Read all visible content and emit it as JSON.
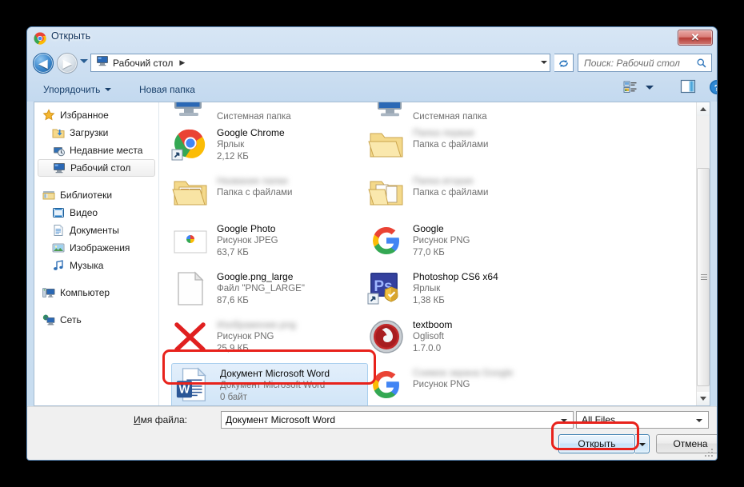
{
  "window": {
    "title": "Открыть",
    "title_icon": "chrome-icon",
    "close_label": "✕"
  },
  "nav": {
    "back_glyph": "◀",
    "forward_glyph": "▶",
    "history_icon": "chevron-down-icon",
    "breadcrumb": "Рабочий стол",
    "breadcrumb_icon": "desktop-icon",
    "breadcrumb_separator": "▶",
    "refresh_icon": "refresh-icon",
    "search_placeholder": "Поиск: Рабочий стол",
    "search_value": "",
    "search_icon": "search-icon"
  },
  "toolbar": {
    "organize_label": "Упорядочить",
    "new_folder_label": "Новая папка",
    "view_icon": "view-mode-icon",
    "view_caret_icon": "chevron-down-icon",
    "preview_pane_icon": "preview-pane-icon",
    "help_icon": "help-icon"
  },
  "sidebar": {
    "groups": [
      {
        "header": {
          "label": "Избранное",
          "icon": "star-icon"
        },
        "items": [
          {
            "label": "Загрузки",
            "icon": "downloads-icon",
            "selected": false
          },
          {
            "label": "Недавние места",
            "icon": "recent-places-icon",
            "selected": false
          },
          {
            "label": "Рабочий стол",
            "icon": "desktop-icon",
            "selected": true
          }
        ]
      },
      {
        "header": {
          "label": "Библиотеки",
          "icon": "libraries-icon"
        },
        "items": [
          {
            "label": "Видео",
            "icon": "video-icon",
            "selected": false
          },
          {
            "label": "Документы",
            "icon": "documents-icon",
            "selected": false
          },
          {
            "label": "Изображения",
            "icon": "pictures-icon",
            "selected": false
          },
          {
            "label": "Музыка",
            "icon": "music-icon",
            "selected": false
          }
        ]
      },
      {
        "header": {
          "label": "Компьютер",
          "icon": "computer-icon"
        },
        "items": []
      },
      {
        "header": {
          "label": "Сеть",
          "icon": "network-icon"
        },
        "items": []
      }
    ]
  },
  "file_list": {
    "column_left": [
      {
        "name": "",
        "type": "Системная папка",
        "size": "",
        "icon": "computer-icon",
        "partial": true,
        "blurred": false,
        "selected": false
      },
      {
        "name": "Google Chrome",
        "type": "Ярлык",
        "size": "2,12 КБ",
        "icon": "chrome-shortcut-icon",
        "partial": false,
        "blurred": false,
        "selected": false
      },
      {
        "name": "Название папки",
        "type": "Папка с файлами",
        "size": "",
        "icon": "folder-pictures-icon",
        "partial": false,
        "blurred": true,
        "selected": false
      },
      {
        "name": "Google Photo",
        "type": "Рисунок JPEG",
        "size": "63,7 КБ",
        "icon": "google-photos-icon",
        "partial": false,
        "blurred": false,
        "selected": false
      },
      {
        "name": "Google.png_large",
        "type": "Файл \"PNG_LARGE\"",
        "size": "87,6 КБ",
        "icon": "blank-file-icon",
        "partial": false,
        "blurred": false,
        "selected": false
      },
      {
        "name": "Изображение.png",
        "type": "Рисунок PNG",
        "size": "25,9 КБ",
        "icon": "red-cross-icon",
        "partial": false,
        "blurred": true,
        "selected": false
      },
      {
        "name": "Документ Microsoft Word",
        "type": "Документ Microsoft Word",
        "size": "0 байт",
        "icon": "word-document-icon",
        "partial": false,
        "blurred": false,
        "selected": true
      }
    ],
    "column_right": [
      {
        "name": "",
        "type": "Системная папка",
        "size": "",
        "icon": "network-computer-icon",
        "partial": true,
        "blurred": false,
        "selected": false
      },
      {
        "name": "Папка первая",
        "type": "Папка с файлами",
        "size": "",
        "icon": "folder-open-icon",
        "partial": false,
        "blurred": true,
        "selected": false
      },
      {
        "name": "Папка вторая",
        "type": "Папка с файлами",
        "size": "",
        "icon": "folder-docs-icon",
        "partial": false,
        "blurred": true,
        "selected": false
      },
      {
        "name": "Google",
        "type": "Рисунок PNG",
        "size": "77,0 КБ",
        "icon": "google-g-icon",
        "partial": false,
        "blurred": false,
        "selected": false
      },
      {
        "name": "Photoshop CS6 x64",
        "type": "Ярлык",
        "size": "1,38 КБ",
        "icon": "photoshop-shortcut-icon",
        "partial": false,
        "blurred": false,
        "selected": false
      },
      {
        "name": "textboom",
        "type": "Oglisoft",
        "size": "1.7.0.0",
        "icon": "textboom-icon",
        "partial": false,
        "blurred": false,
        "selected": false
      },
      {
        "name": "Снимок экрана Google",
        "type": "Рисунок PNG",
        "size": "",
        "icon": "google-g-icon",
        "partial": false,
        "blurred": true,
        "selected": false
      }
    ]
  },
  "scrollbar": {
    "up_icon": "scroll-up-arrow-icon",
    "down_icon": "scroll-down-arrow-icon",
    "grip_icon": "scroll-grip-icon"
  },
  "bottom": {
    "filename_label_prefix": "И",
    "filename_label_rest": "мя файла:",
    "filename_value": "Документ Microsoft Word",
    "filename_caret_icon": "chevron-down-icon",
    "filter_value": "All Files",
    "filter_caret_icon": "chevron-down-icon",
    "open_label": "Открыть",
    "open_accel": "О",
    "open_split_icon": "chevron-down-icon",
    "cancel_label": "Отмена"
  },
  "annotations": {
    "accent_color": "#e8221b",
    "file_box": "selected-file-highlight",
    "open_box": "open-button-highlight"
  }
}
